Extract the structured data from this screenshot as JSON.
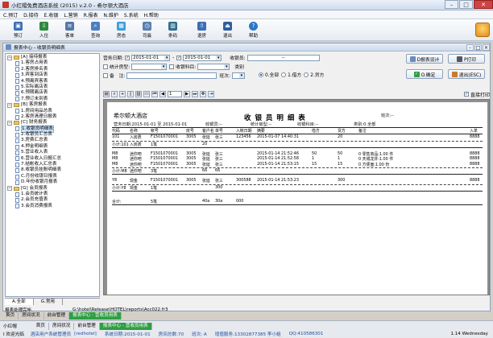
{
  "window": {
    "title": "小红帽免费酒店系统 (2015) v.2.0 - 希尔顿大酒店"
  },
  "menu": [
    "C.预订",
    "D.接待",
    "E.收银",
    "L.营销",
    "R.报表",
    "N.维护",
    "S.系统",
    "H.帮助"
  ],
  "toolbar": [
    "预订",
    "入住",
    "客单",
    "查询",
    "房态",
    "司晨",
    "条码",
    "退房",
    "退出",
    "帮助"
  ],
  "subwindow": {
    "title": "报表中心 - 收银员明细表"
  },
  "tree": [
    {
      "label": "[A] 接待报表",
      "level": 0,
      "type": "folder"
    },
    {
      "label": "1.客房占用表",
      "level": 1,
      "type": "doc"
    },
    {
      "label": "2.客房排名表",
      "level": 1,
      "type": "doc"
    },
    {
      "label": "3.宾客到店表",
      "level": 1,
      "type": "doc"
    },
    {
      "label": "4.预离宾客表",
      "level": 1,
      "type": "doc"
    },
    {
      "label": "5.实际离店表",
      "level": 1,
      "type": "doc"
    },
    {
      "label": "6.预期离店表",
      "level": 1,
      "type": "doc"
    },
    {
      "label": "7.预订未到表",
      "level": 1,
      "type": "doc"
    },
    {
      "label": "[B] 客房报表",
      "level": 0,
      "type": "folder"
    },
    {
      "label": "1.房间用品总表",
      "level": 1,
      "type": "doc"
    },
    {
      "label": "2.客房清理日报表",
      "level": 1,
      "type": "doc"
    },
    {
      "label": "[C] 财务报表",
      "level": 0,
      "type": "folder"
    },
    {
      "label": "1.收银员明细表",
      "level": 1,
      "type": "doc",
      "selected": true
    },
    {
      "label": "2.收银员汇总表",
      "level": 1,
      "type": "doc"
    },
    {
      "label": "3.房费汇总表",
      "level": 1,
      "type": "doc"
    },
    {
      "label": "4.押金明细表",
      "level": 1,
      "type": "doc"
    },
    {
      "label": "5.营业收入表",
      "level": 1,
      "type": "doc"
    },
    {
      "label": "6.营业收入日报汇总",
      "level": 1,
      "type": "doc"
    },
    {
      "label": "7.结帐收入汇总表",
      "level": 1,
      "type": "doc"
    },
    {
      "label": "8.收银员挂账明细表",
      "level": 1,
      "type": "doc"
    },
    {
      "label": "C.月份收银日报表",
      "level": 1,
      "type": "doc"
    },
    {
      "label": "D.年份收银月报表",
      "level": 1,
      "type": "doc"
    },
    {
      "label": "[G] 会员报表",
      "level": 0,
      "type": "folder"
    },
    {
      "label": "1.会员统计表",
      "level": 1,
      "type": "doc"
    },
    {
      "label": "2.会员充值表",
      "level": 1,
      "type": "doc"
    },
    {
      "label": "3.会员消费报表",
      "level": 1,
      "type": "doc"
    }
  ],
  "left_tabs": [
    "A.全部",
    "G.常用"
  ],
  "filter": {
    "date_label": "营务日期:",
    "date_from": "2015-01-01",
    "date_to": "2015-01-01",
    "cashier_label": "收银员:",
    "cashier_value": "--",
    "stat_label": "统计房型:",
    "subject_label": "收银科目:",
    "cat_label": "类别",
    "notes_label": "备　注:",
    "shift_label": "班次:",
    "radios": [
      "0.全部",
      "1.借方",
      "2.贷方"
    ],
    "design_btn": "D报表设计",
    "print_btn": "P打印",
    "ok_btn": "O.确定",
    "exit_btn": "退出(ESC)",
    "direct_print": "直接打印",
    "page_no": "1"
  },
  "report": {
    "title": "收 银 员 明 细 表",
    "hotel": "希尔顿大酒店",
    "meta": [
      "营务日期:2015-01-01 至 2015-01-01",
      "收银员:--",
      "统计房型:--",
      "收银科目:--",
      "类别:0.全部",
      "班次:--"
    ],
    "header": [
      "代码",
      "名称",
      "帐号",
      "房号",
      "客户名",
      "单号",
      "入帐日期",
      "摘要",
      "借方",
      "贷方",
      "备注",
      "入单"
    ],
    "groups": [
      {
        "rows": [
          [
            "101",
            "入房费",
            "F1501070001",
            "3005",
            "张延",
            "张三",
            "123456",
            "2015-01-07 14:40:31",
            "",
            "20",
            "",
            "8888"
          ]
        ],
        "subtotal": [
          "小计:101",
          "入房费",
          "1笔",
          "",
          "20",
          ""
        ]
      },
      {
        "rows": [
          [
            "M8",
            "迷你吧",
            "F1501070001",
            "3005",
            "张延",
            "张三",
            "",
            "2015-01-14 21:52:46",
            "50",
            "50",
            "0 零售商品:1.00 件",
            "8888"
          ],
          [
            "M8",
            "迷你吧",
            "F1501070001",
            "3005",
            "张延",
            "张三",
            "",
            "2015-01-14 21:52:58",
            "1",
            "1",
            "0 天城龙井:1.00 件",
            "8888"
          ],
          [
            "M8",
            "迷你吧",
            "F1501070001",
            "3005",
            "张延",
            "张三",
            "",
            "2015-01-14 21:53:15",
            "15",
            "15",
            "0 方便面:1.00 份",
            "8888"
          ]
        ],
        "subtotal": [
          "小计:M8",
          "迷你吧",
          "3笔",
          "",
          "66",
          "66"
        ]
      },
      {
        "rows": [
          [
            "Y8",
            "现金",
            "F1501070001",
            "3005",
            "张延",
            "张三",
            "300588",
            "2015-01-14 21:53:23",
            "",
            "300",
            "",
            "8888"
          ]
        ],
        "subtotal": [
          "小计:Y8",
          "现金",
          "1笔",
          "",
          "",
          "300"
        ]
      }
    ],
    "total": [
      "合计:",
      "",
      "5笔",
      "",
      "40a",
      "30a",
      "000"
    ]
  },
  "path": {
    "left": "报表处理完毕.",
    "right": "G:\\hotel\\Release\\HOTEL\\reports\\Acc022.fr3"
  },
  "window_tabs": [
    "首页",
    "房间状况",
    "前台管理",
    "报表中心 - 营收员用表"
  ],
  "status": {
    "user": "小红帽",
    "tabs": [
      "首页",
      "房间状况",
      "前台管理",
      "报表中心 - 营收员用表"
    ],
    "left2": "I 欢迎光临",
    "app": "酒店用户系统管理员",
    "code": "[redhotel]",
    "sysdate": "系统日期:2015-01-01",
    "rooms": "房间总数:70",
    "shift": "班次: A",
    "phone": "增值服务:13302877385 李小姐",
    "qq": "QQ:410586301",
    "time": "1.14 Wednesday"
  },
  "colors": {
    "accent": "#2f9e44",
    "title_bg": "#cfdcec",
    "link": "#1f4ea3"
  }
}
